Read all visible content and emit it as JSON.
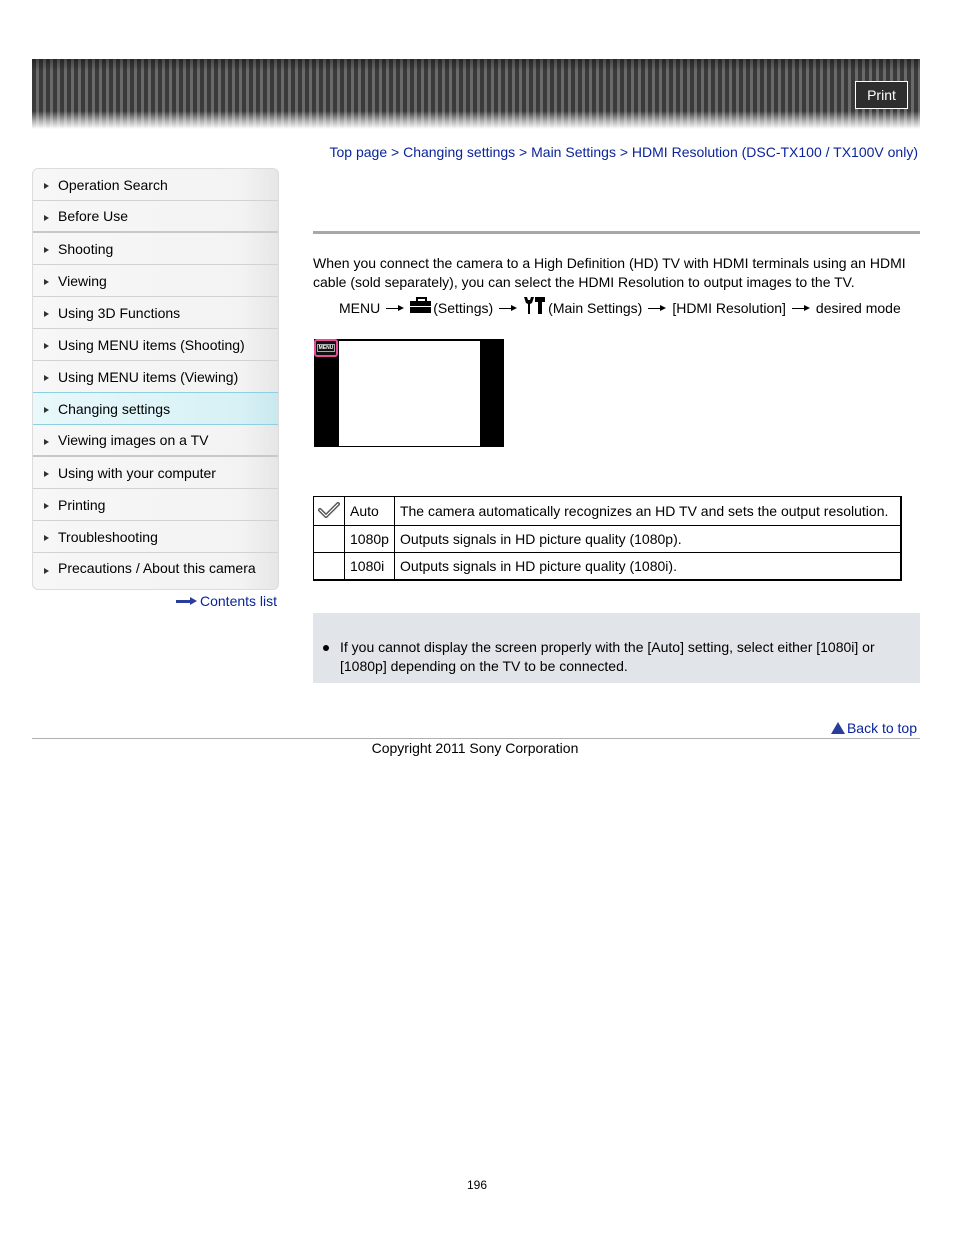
{
  "header": {
    "print_label": "Print"
  },
  "breadcrumb": {
    "items": [
      "Top page",
      "Changing settings",
      "Main Settings",
      "HDMI Resolution (DSC-TX100 / TX100V only)"
    ],
    "separator": ">"
  },
  "sidebar": {
    "items": [
      {
        "label": "Operation Search",
        "active": false
      },
      {
        "label": "Before Use",
        "active": false
      },
      {
        "label": "Shooting",
        "active": false
      },
      {
        "label": "Viewing",
        "active": false
      },
      {
        "label": "Using 3D Functions",
        "active": false
      },
      {
        "label": "Using MENU items (Shooting)",
        "active": false
      },
      {
        "label": "Using MENU items (Viewing)",
        "active": false
      },
      {
        "label": "Changing settings",
        "active": true
      },
      {
        "label": "Viewing images on a TV",
        "active": false
      },
      {
        "label": "Using with your computer",
        "active": false
      },
      {
        "label": "Printing",
        "active": false
      },
      {
        "label": "Troubleshooting",
        "active": false
      },
      {
        "label": "Precautions / About this camera",
        "active": false
      }
    ],
    "contents_list_label": "Contents list",
    "accent_color": "#d7f1f5"
  },
  "main": {
    "intro": "When you connect the camera to a High Definition (HD) TV with HDMI terminals using an HDMI cable (sold separately), you can select the HDMI Resolution to output images to the TV.",
    "menu_path": {
      "start": "MENU",
      "step1": "(Settings)",
      "step2": "(Main Settings)",
      "step3": "[HDMI Resolution]",
      "step4": "desired mode"
    },
    "screen_image": {
      "menu_tag": "MENU",
      "highlight_color": "#ea4d9a"
    },
    "table": {
      "rows": [
        {
          "default": true,
          "mode": "Auto",
          "description": "The camera automatically recognizes an HD TV and sets the output resolution."
        },
        {
          "default": false,
          "mode": "1080p",
          "description": "Outputs signals in HD picture quality (1080p)."
        },
        {
          "default": false,
          "mode": "1080i",
          "description": "Outputs signals in HD picture quality (1080i)."
        }
      ]
    },
    "note": "If you cannot display the screen properly with the [Auto] setting, select either [1080i] or [1080p] depending on the TV to be connected."
  },
  "footer": {
    "back_to_top": "Back to top",
    "copyright": "Copyright 2011 Sony Corporation",
    "page_number": "196"
  },
  "colors": {
    "link": "#0a249b",
    "note_bg": "#e1e4e8",
    "rule": "#a8a8a8"
  }
}
